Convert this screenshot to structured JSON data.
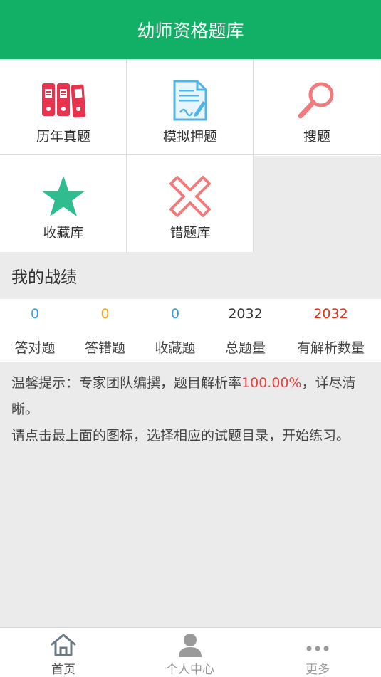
{
  "header": {
    "title": "幼师资格题库"
  },
  "menu": {
    "items": [
      {
        "label": "历年真题",
        "icon": "binders-icon"
      },
      {
        "label": "模拟押题",
        "icon": "document-pen-icon"
      },
      {
        "label": "搜题",
        "icon": "search-icon"
      },
      {
        "label": "收藏库",
        "icon": "star-icon"
      },
      {
        "label": "错题库",
        "icon": "x-mark-icon"
      }
    ]
  },
  "stats": {
    "title": "我的战绩",
    "items": [
      {
        "value": "0",
        "label": "答对题",
        "color": "#3a9bd9"
      },
      {
        "value": "0",
        "label": "答错题",
        "color": "#f5a623"
      },
      {
        "value": "0",
        "label": "收藏题",
        "color": "#3a9bd9"
      },
      {
        "value": "2032",
        "label": "总题量",
        "color": "#333333"
      },
      {
        "value": "2032",
        "label": "有解析数量",
        "color": "#e0341b"
      }
    ]
  },
  "tips": {
    "prefix": "温馨提示：专家团队编撰，题目解析率",
    "rate": "100.00%",
    "suffix": "，详尽清晰。",
    "line2": "请点击最上面的图标，选择相应的试题目录，开始练习。"
  },
  "tabbar": {
    "items": [
      {
        "label": "首页",
        "icon": "home-icon"
      },
      {
        "label": "个人中心",
        "icon": "user-icon"
      },
      {
        "label": "更多",
        "icon": "more-icon"
      }
    ]
  },
  "colors": {
    "primary": "#12b066",
    "binder": "#e8334f",
    "star": "#2fbd8f",
    "xmark": "#f07a7c",
    "search": "#f07a7c",
    "doc": "#4fb4e6"
  }
}
